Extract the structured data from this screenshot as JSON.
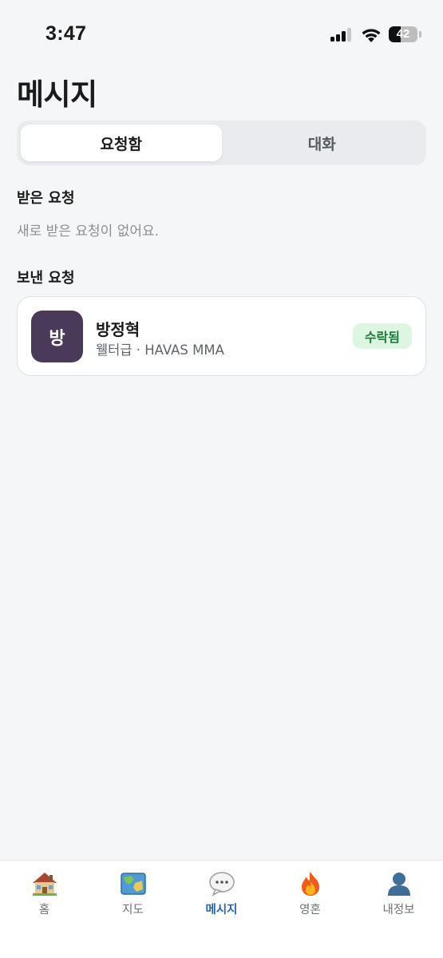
{
  "status_bar": {
    "time": "3:47",
    "battery": "42",
    "battery_level": 0.42
  },
  "header": {
    "title": "메시지"
  },
  "segmented": {
    "tabs": [
      {
        "label": "요청함",
        "active": true
      },
      {
        "label": "대화",
        "active": false
      }
    ]
  },
  "received": {
    "title": "받은 요청",
    "empty_text": "새로 받은 요청이 없어요."
  },
  "sent": {
    "title": "보낸 요청",
    "items": [
      {
        "avatar_text": "방",
        "name": "방정혁",
        "subtitle": "웰터급 · HAVAS MMA",
        "status": "수락됨",
        "avatar_color": "#4a3a5a",
        "status_color": "#1f7a36"
      }
    ]
  },
  "tab_bar": {
    "items": [
      {
        "label": "홈",
        "icon": "house-icon"
      },
      {
        "label": "지도",
        "icon": "map-icon"
      },
      {
        "label": "메시지",
        "icon": "speech-bubble-icon",
        "active": true
      },
      {
        "label": "영혼",
        "icon": "fire-icon"
      },
      {
        "label": "내정보",
        "icon": "person-icon"
      }
    ]
  },
  "colors": {
    "accent": "#2563b8",
    "background": "#f5f6f8",
    "badge_bg": "#dcf6e2"
  }
}
